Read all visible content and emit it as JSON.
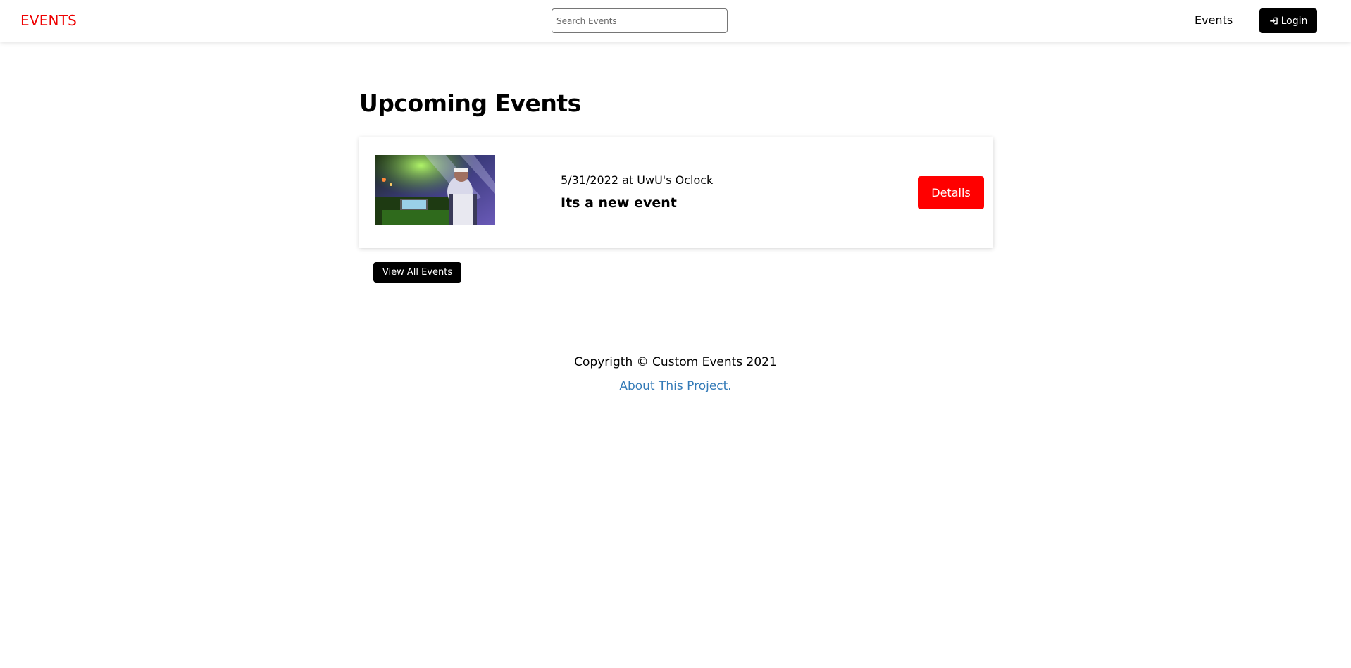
{
  "navbar": {
    "brand": "EVENTS",
    "search_placeholder": "Search Events",
    "events_link": "Events",
    "login_label": "Login"
  },
  "main": {
    "heading": "Upcoming Events",
    "events": [
      {
        "date_location": "5/31/2022 at UwU's Oclock",
        "title": "Its a new event",
        "details_label": "Details"
      }
    ],
    "view_all_label": "View All Events"
  },
  "footer": {
    "copyright": "Copyrigth © Custom Events 2021",
    "about_link": "About This Project."
  },
  "colors": {
    "brand": "#ee0000",
    "details_button": "#ff0000",
    "dark_button": "#000000",
    "link": "#337ab7"
  },
  "icons": {
    "login": "sign-in-icon"
  }
}
